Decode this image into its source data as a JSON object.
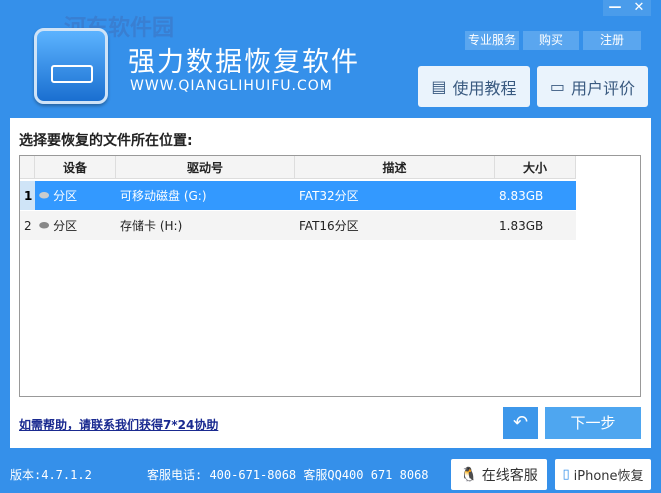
{
  "window": {
    "minimize": "—",
    "close": "✕"
  },
  "watermark": "河东软件园",
  "app": {
    "title": "强力数据恢复软件",
    "url": "WWW.QIANGLIHUIFU.COM"
  },
  "header": {
    "pro_service": "专业服务",
    "buy": "购买",
    "register": "注册",
    "tutorial": "使用教程",
    "reviews": "用户评价"
  },
  "main": {
    "heading": "选择要恢复的文件所在位置:",
    "columns": [
      "设备",
      "驱动号",
      "描述",
      "大小"
    ],
    "rows": [
      {
        "index": "1",
        "device": "分区",
        "drive": "可移动磁盘 (G:)",
        "desc": "FAT32分区",
        "size": "8.83GB"
      },
      {
        "index": "2",
        "device": "分区",
        "drive": "存储卡 (H:)",
        "desc": "FAT16分区",
        "size": "1.83GB"
      }
    ]
  },
  "help_link": "如需帮助，请联系我们获得7*24协助",
  "buttons": {
    "back": "↶",
    "next": "下一步"
  },
  "footer": {
    "version": "版本:4.7.1.2",
    "contact": "客服电话: 400-671-8068 客服QQ400 671 8068",
    "online": "在线客服",
    "iphone": "iPhone恢复"
  }
}
